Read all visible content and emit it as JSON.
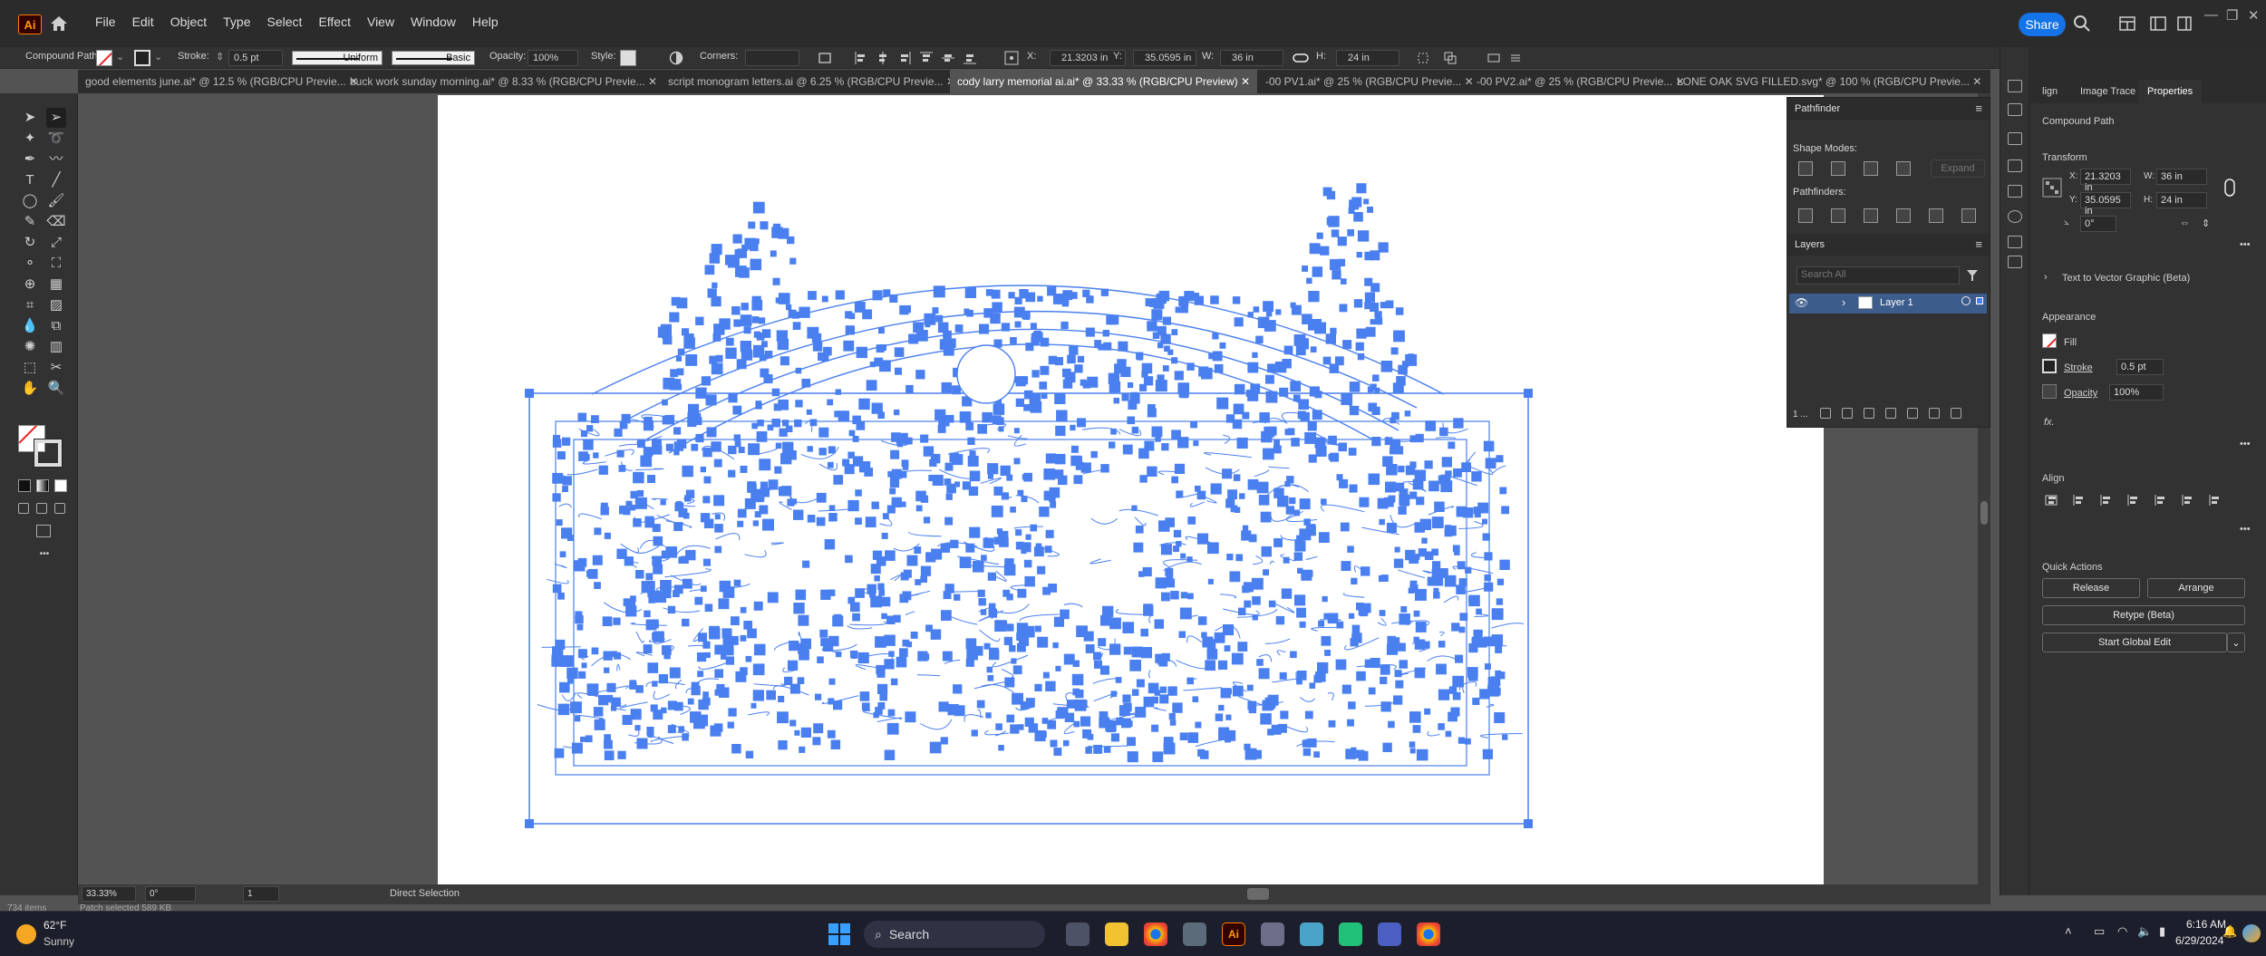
{
  "menu": [
    "File",
    "Edit",
    "Object",
    "Type",
    "Select",
    "Effect",
    "View",
    "Window",
    "Help"
  ],
  "share_label": "Share",
  "control": {
    "object_type": "Compound Path",
    "stroke_label": "Stroke:",
    "stroke_value": "0.5 pt",
    "profile_uniform": "Uniform",
    "brush_basic": "Basic",
    "opacity_label": "Opacity:",
    "opacity_value": "100%",
    "style_label": "Style:",
    "corners_label": "Corners:",
    "x_label": "X:",
    "x_value": "21.3203 in",
    "y_label": "Y:",
    "y_value": "35.0595 in",
    "w_label": "W:",
    "w_value": "36 in",
    "h_label": "H:",
    "h_value": "24 in"
  },
  "tabs": [
    "good elements june.ai* @ 12.5 % (RGB/CPU Previe...",
    "buck work sunday morning.ai* @ 8.33 % (RGB/CPU Previe...",
    "script monogram letters.ai @ 6.25 % (RGB/CPU Previe...",
    "cody larry memorial ai.ai* @ 33.33 % (RGB/CPU Preview)",
    "-00 PV1.ai* @ 25 % (RGB/CPU Previe...",
    "-00 PV2.ai* @ 25 % (RGB/CPU Previe...",
    "LONE OAK SVG FILLED.svg* @ 100 % (RGB/CPU Previe..."
  ],
  "pathfinder": {
    "title": "Pathfinder",
    "shape_modes": "Shape Modes:",
    "expand": "Expand",
    "pathfinders": "Pathfinders:"
  },
  "layers": {
    "title": "Layers",
    "search_placeholder": "Search All",
    "layer_name": "Layer 1",
    "count": "1 ..."
  },
  "props": {
    "tab_align": "lign",
    "tab_trace": "Image Trace",
    "tab_props": "Properties",
    "object": "Compound Path",
    "transform": "Transform",
    "x_label": "X:",
    "x": "21.3203 in",
    "y_label": "Y:",
    "y": "35.0595 in",
    "w_label": "W:",
    "w": "36 in",
    "h_label": "H:",
    "h": "24 in",
    "angle": "0°",
    "text_to_vector": "Text to Vector Graphic (Beta)",
    "appearance": "Appearance",
    "fill": "Fill",
    "stroke": "Stroke",
    "stroke_value": "0.5 pt",
    "opacity": "Opacity",
    "opacity_value": "100%",
    "fx": "fx.",
    "align": "Align",
    "quick_actions": "Quick Actions",
    "release": "Release",
    "arrange": "Arrange",
    "retype": "Retype (Beta)",
    "global_edit": "Start Global Edit"
  },
  "status": {
    "zoom": "33.33%",
    "rotation": "0°",
    "artboard": "1",
    "tool": "Direct Selection",
    "items": "734 items",
    "info": "Patch selected 589 KB"
  },
  "taskbar": {
    "temp": "62°F",
    "weather": "Sunny",
    "search": "Search",
    "time": "6:16 AM",
    "date": "6/29/2024"
  },
  "colors": {
    "selection": "#4a7ff0",
    "accent": "#1473e6"
  }
}
